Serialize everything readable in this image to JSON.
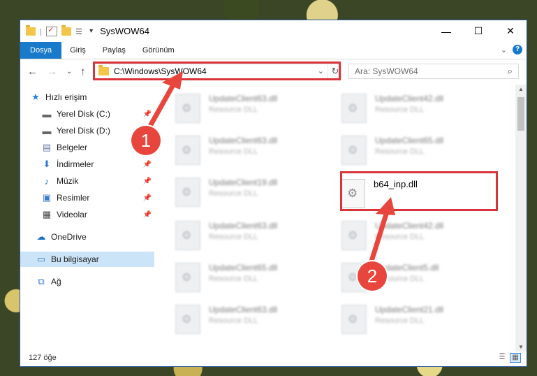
{
  "window": {
    "title": "SysWOW64",
    "controls": {
      "minimize": "—",
      "maximize": "☐",
      "close": "✕"
    }
  },
  "ribbon": {
    "tabs": [
      "Dosya",
      "Giriş",
      "Paylaş",
      "Görünüm"
    ],
    "collapse": "⌄",
    "help": "?"
  },
  "nav": {
    "back": "←",
    "forward": "→",
    "recent": "⌄",
    "up": "↑",
    "address": "C:\\Windows\\SysWOW64",
    "address_dropdown": "⌄",
    "refresh": "↻",
    "search_placeholder": "Ara: SysWOW64",
    "search_icon": "⌕"
  },
  "sidebar": {
    "items": [
      {
        "label": "Hızlı erişim",
        "icon": "★",
        "pinned": false
      },
      {
        "label": "Yerel Disk (C:)",
        "icon": "▬",
        "pinned": true
      },
      {
        "label": "Yerel Disk (D:)",
        "icon": "▬",
        "pinned": false
      },
      {
        "label": "Belgeler",
        "icon": "▤",
        "pinned": true
      },
      {
        "label": "İndirmeler",
        "icon": "⬇",
        "pinned": true
      },
      {
        "label": "Müzik",
        "icon": "♪",
        "pinned": true
      },
      {
        "label": "Resimler",
        "icon": "▣",
        "pinned": true
      },
      {
        "label": "Videolar",
        "icon": "▦",
        "pinned": true
      },
      {
        "label": "OneDrive",
        "icon": "☁",
        "pinned": false
      },
      {
        "label": "Bu bilgisayar",
        "icon": "▭",
        "pinned": false,
        "selected": true
      },
      {
        "label": "Ağ",
        "icon": "⧉",
        "pinned": false
      }
    ],
    "pin_glyph": "📌"
  },
  "files": [
    {
      "name": "UpdateClient63.dll",
      "desc": "Resource DLL"
    },
    {
      "name": "UpdateClient42.dll",
      "desc": "Resource DLL"
    },
    {
      "name": "UpdateClient63.dll",
      "desc": "Resource DLL"
    },
    {
      "name": "UpdateClient65.dll",
      "desc": "Resource DLL"
    },
    {
      "name": "UpdateClient19.dll",
      "desc": "Resource DLL"
    },
    {
      "name": "b64_inp.dll",
      "desc": ""
    },
    {
      "name": "UpdateClient63.dll",
      "desc": "Resource DLL"
    },
    {
      "name": "UpdateClient42.dll",
      "desc": "Resource DLL"
    },
    {
      "name": "UpdateClient65.dll",
      "desc": "Resource DLL"
    },
    {
      "name": "UpdateClient5.dll",
      "desc": "Resource DLL"
    },
    {
      "name": "UpdateClient63.dll",
      "desc": "Resource DLL"
    },
    {
      "name": "UpdateClient21.dll",
      "desc": "Resource DLL"
    }
  ],
  "status": {
    "count": "127 öğe"
  },
  "annotations": {
    "step1": "1",
    "step2": "2"
  },
  "colors": {
    "accent": "#1979ca",
    "highlight": "#d9343a",
    "selected": "#cce4f7"
  }
}
